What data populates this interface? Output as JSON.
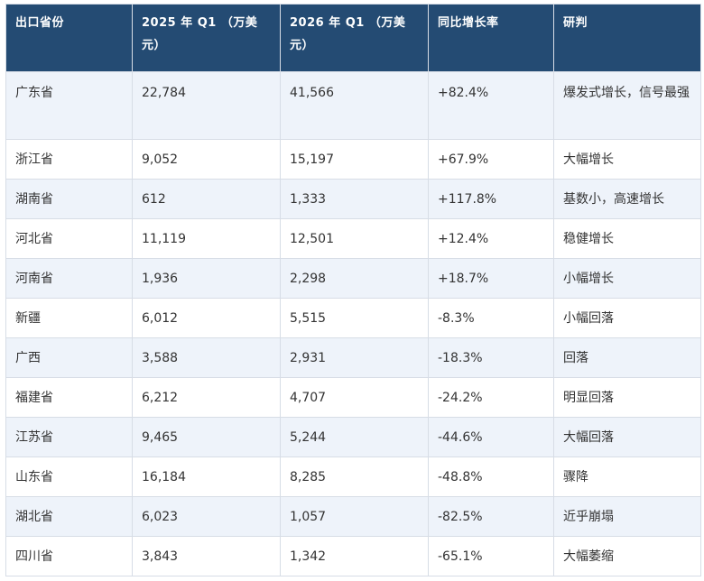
{
  "table": {
    "headers": [
      "出口省份",
      "2025 年 Q1 （万美元）",
      "2026 年 Q1 （万美元）",
      "同比增长率",
      "研判"
    ],
    "rows": [
      [
        "广东省",
        "22,784",
        "41,566",
        "+82.4%",
        "爆发式增长，信号最强"
      ],
      [
        "浙江省",
        "9,052",
        "15,197",
        "+67.9%",
        "大幅增长"
      ],
      [
        "湖南省",
        "612",
        "1,333",
        "+117.8%",
        "基数小，高速增长"
      ],
      [
        "河北省",
        "11,119",
        "12,501",
        "+12.4%",
        "稳健增长"
      ],
      [
        "河南省",
        "1,936",
        "2,298",
        "+18.7%",
        "小幅增长"
      ],
      [
        "新疆",
        "6,012",
        "5,515",
        "-8.3%",
        "小幅回落"
      ],
      [
        "广西",
        "3,588",
        "2,931",
        "-18.3%",
        "回落"
      ],
      [
        "福建省",
        "6,212",
        "4,707",
        "-24.2%",
        "明显回落"
      ],
      [
        "江苏省",
        "9,465",
        "5,244",
        "-44.6%",
        "大幅回落"
      ],
      [
        "山东省",
        "16,184",
        "8,285",
        "-48.8%",
        "骤降"
      ],
      [
        "湖北省",
        "6,023",
        "1,057",
        "-82.5%",
        "近乎崩塌"
      ],
      [
        "四川省",
        "3,843",
        "1,342",
        "-65.1%",
        "大幅萎缩"
      ]
    ]
  },
  "colors": {
    "header_bg": "#244b73",
    "header_text": "#ffffff",
    "row_alt_bg": "#eef3fa",
    "border": "#d7dde6"
  }
}
